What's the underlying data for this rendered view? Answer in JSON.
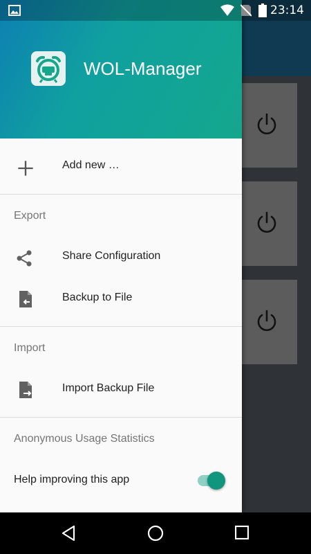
{
  "status_bar": {
    "time": "23:14",
    "icons": [
      "image-icon",
      "wifi-icon",
      "no-sim-icon",
      "battery-icon"
    ]
  },
  "app": {
    "title": "WOL-Manager",
    "header_gradient": [
      "#0d7fb3",
      "#14a78c"
    ],
    "accent": "#10967f"
  },
  "drawer": {
    "add_new": {
      "label": "Add new …",
      "icon": "plus-icon"
    },
    "export": {
      "header": "Export",
      "items": [
        {
          "label": "Share Configuration",
          "icon": "share-icon"
        },
        {
          "label": "Backup to File",
          "icon": "file-export-icon"
        }
      ]
    },
    "import": {
      "header": "Import",
      "items": [
        {
          "label": "Import Backup File",
          "icon": "file-import-icon"
        }
      ]
    },
    "statistics": {
      "header": "Anonymous Usage Statistics",
      "toggle_label": "Help improving this app",
      "toggle_on": true
    }
  },
  "background_cards": [
    {
      "icon": "power-icon"
    },
    {
      "icon": "power-icon"
    },
    {
      "icon": "power-icon"
    }
  ],
  "nav_bar": {
    "buttons": [
      "back-icon",
      "home-icon",
      "recents-icon"
    ]
  }
}
